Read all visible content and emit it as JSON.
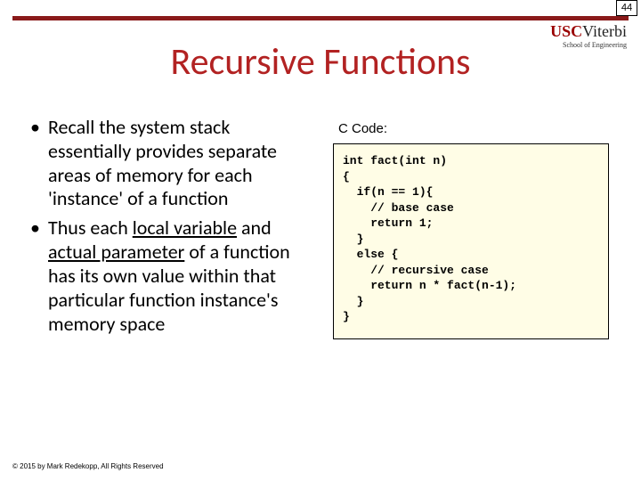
{
  "page_number": "44",
  "logo": {
    "usc": "USC",
    "viterbi": "Viterbi",
    "subtitle": "School of Engineering"
  },
  "title": "Recursive Functions",
  "bullets": [
    {
      "text": "Recall the system stack essentially provides separate areas of memory for each 'instance' of a function"
    },
    {
      "prefix": "Thus each ",
      "u1": "local variable",
      "mid": " and ",
      "u2": "actual parameter",
      "suffix": " of a function has its own value within that particular function instance's memory space"
    }
  ],
  "code": {
    "label": "C Code:",
    "lines": "int fact(int n)\n{\n  if(n == 1){\n    // base case\n    return 1;\n  }\n  else {\n    // recursive case\n    return n * fact(n-1);\n  }\n}"
  },
  "copyright": "© 2015 by Mark Redekopp, All Rights Reserved"
}
